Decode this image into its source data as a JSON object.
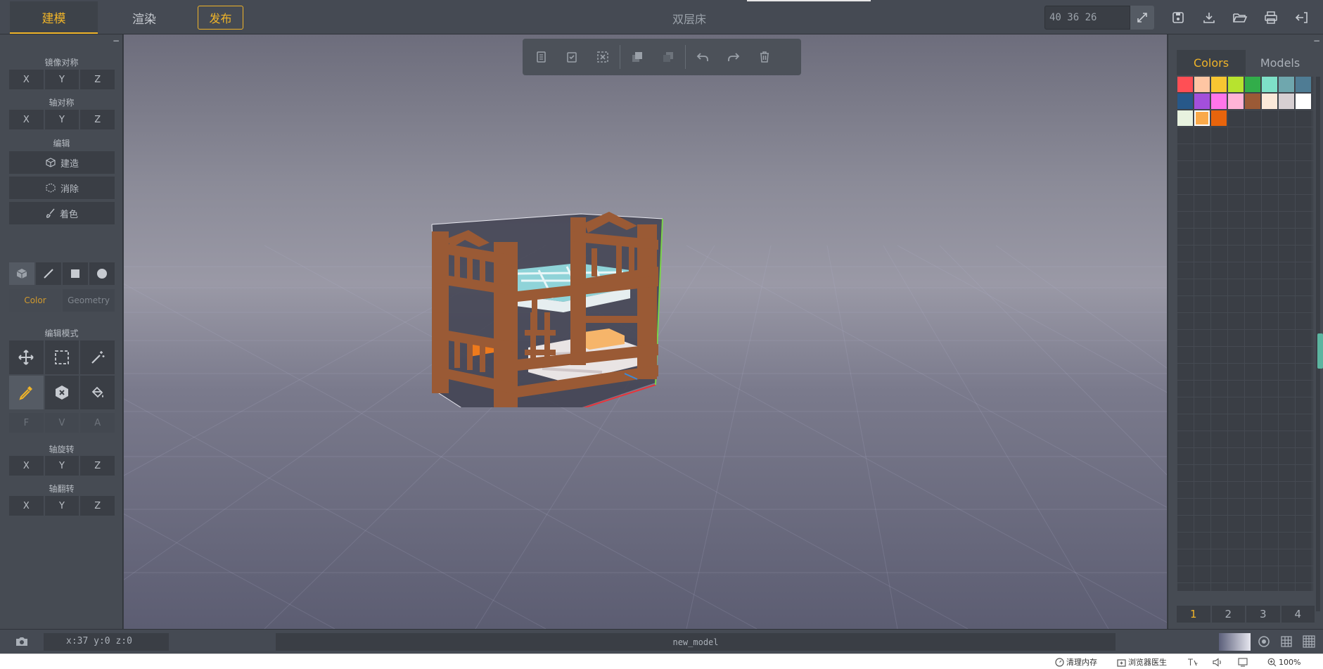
{
  "header": {
    "tabs": [
      {
        "label": "建模",
        "active": true
      },
      {
        "label": "渲染",
        "active": false
      }
    ],
    "publish_label": "发布",
    "title": "双层床",
    "size_value": "40 36 26"
  },
  "left_panel": {
    "mirror": {
      "title": "镜像对称",
      "x": "X",
      "y": "Y",
      "z": "Z"
    },
    "axis_sym": {
      "title": "轴对称",
      "x": "X",
      "y": "Y",
      "z": "Z"
    },
    "edit": {
      "title": "编辑",
      "build": "建造",
      "erase": "消除",
      "paint": "着色"
    },
    "shape_tabs": {
      "color": "Color",
      "geometry": "Geometry"
    },
    "edit_mode_title": "编辑模式",
    "fva": {
      "f": "F",
      "v": "V",
      "a": "A"
    },
    "axis_rotate": {
      "title": "轴旋转",
      "x": "X",
      "y": "Y",
      "z": "Z"
    },
    "axis_flip": {
      "title": "轴翻转",
      "x": "X",
      "y": "Y",
      "z": "Z"
    }
  },
  "right_panel": {
    "tabs": [
      {
        "label": "Colors",
        "active": true
      },
      {
        "label": "Models",
        "active": false
      }
    ],
    "swatches": [
      "#ff4f55",
      "#ffc6a3",
      "#f8c632",
      "#b7e32f",
      "#32ad4a",
      "#7ee0c8",
      "#6fa7ae",
      "#4f7c94",
      "#275889",
      "#a34fdb",
      "#ff75ea",
      "#ffb3d6",
      "#9b5a36",
      "#fbe9d9",
      "#d6cfd2",
      "#ffffff",
      "#e8f2df",
      "#f9a94a",
      "#e8640c"
    ],
    "selected_swatch": 17,
    "pages": [
      "1",
      "2",
      "3",
      "4"
    ],
    "active_page": "1"
  },
  "bottom_bar": {
    "coords": "x:37 y:0 z:0",
    "model_name": "new_model"
  },
  "status_bar": {
    "clear_memory": "清理内存",
    "browser_doctor": "浏览器医生",
    "zoom": "100%"
  }
}
